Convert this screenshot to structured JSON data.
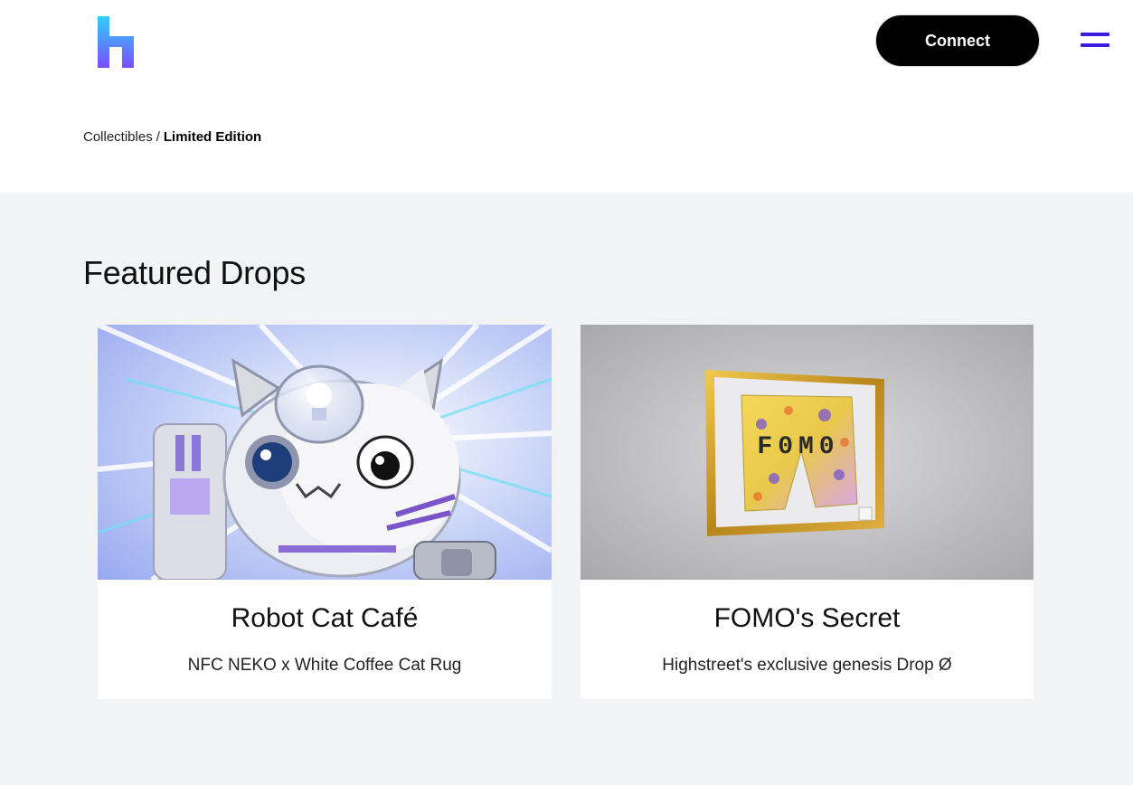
{
  "header": {
    "connect_label": "Connect"
  },
  "breadcrumb": {
    "parent": "Collectibles",
    "separator": "/",
    "current": "Limited Edition"
  },
  "section": {
    "title": "Featured Drops"
  },
  "cards": [
    {
      "title": "Robot Cat Café",
      "subtitle": "NFC NEKO x White Coffee Cat Rug"
    },
    {
      "title": "FOMO's Secret",
      "subtitle": "Highstreet's exclusive genesis Drop Ø",
      "image_text": "F0M0"
    }
  ],
  "colors": {
    "logo_gradient_top": "#35c6f4",
    "logo_gradient_bottom": "#7b4dff",
    "menu": "#3a1be0",
    "section_bg": "#f2f3f4"
  }
}
